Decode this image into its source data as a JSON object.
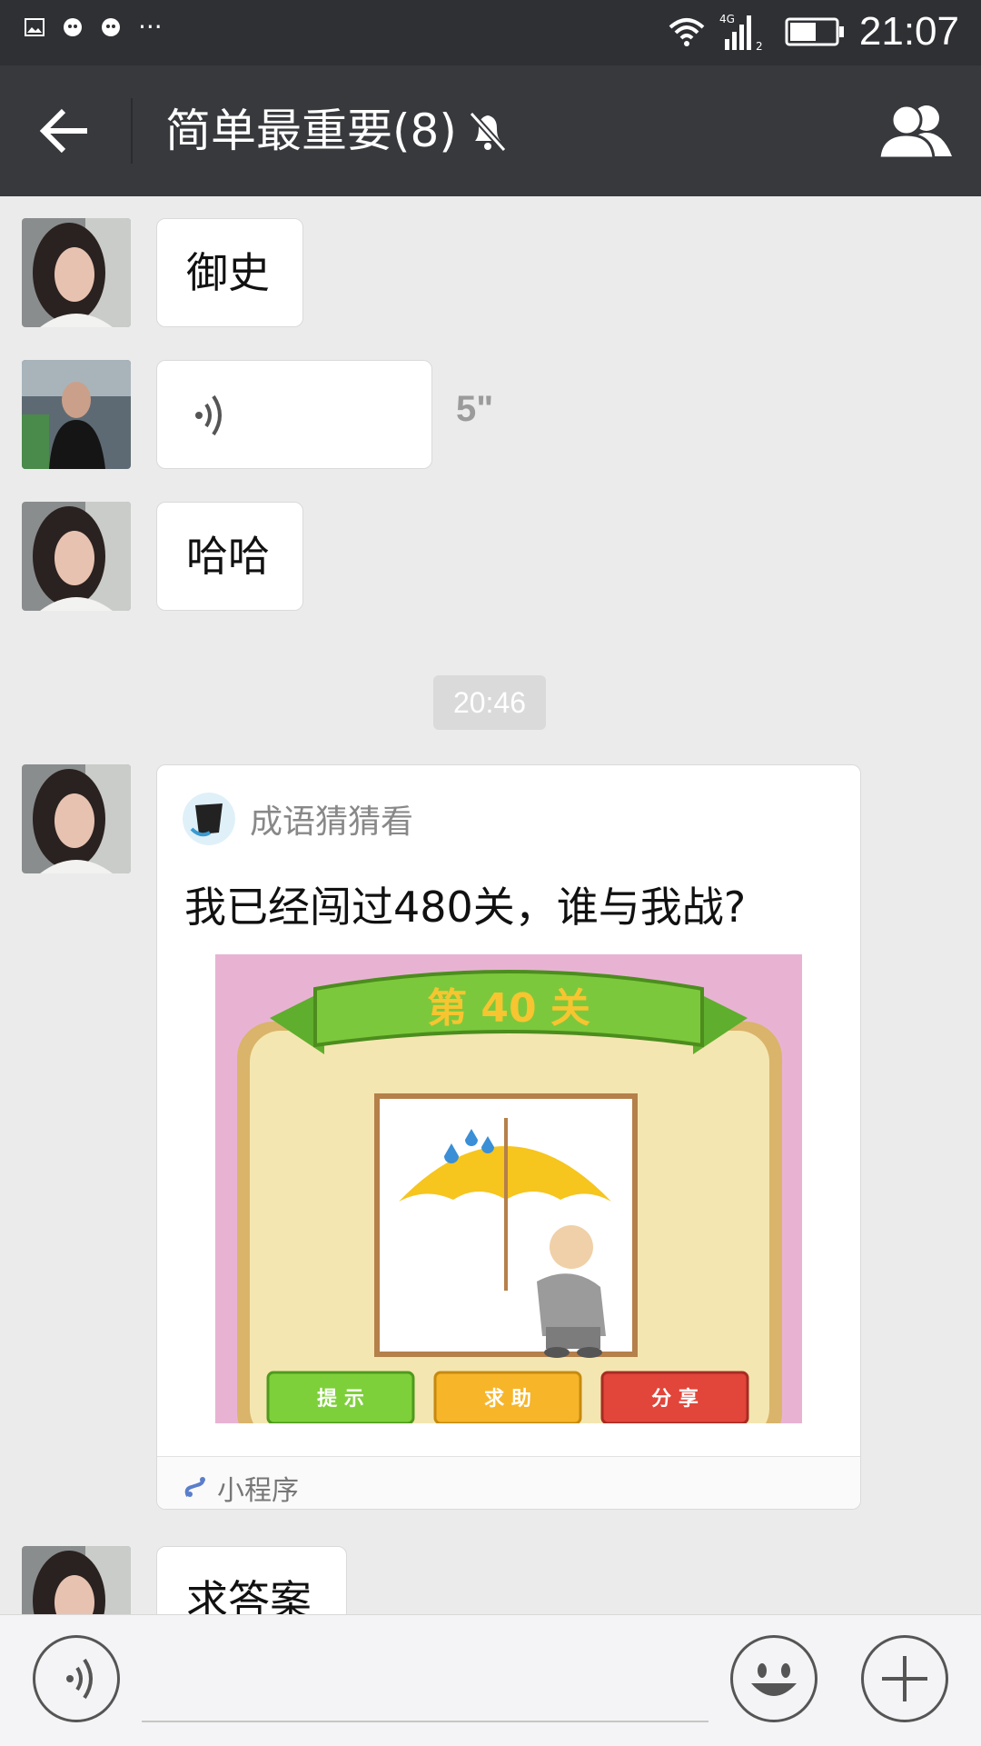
{
  "status_bar": {
    "time": "21:07",
    "network": "4G",
    "sim": "2",
    "overflow": "···"
  },
  "nav": {
    "title": "简单最重要(8)",
    "icons": [
      "back-arrow-icon",
      "mute-bell-icon",
      "group-members-icon"
    ]
  },
  "messages": [
    {
      "type": "text",
      "text": "御史"
    },
    {
      "type": "voice",
      "duration": "5\""
    },
    {
      "type": "text",
      "text": "哈哈"
    },
    {
      "type": "time",
      "text": "20:46"
    },
    {
      "type": "mini_program",
      "app_name": "成语猜猜看",
      "title": "我已经闯过480关，谁与我战?",
      "preview": {
        "level_text": "第 40 关",
        "buttons": [
          "提 示",
          "求 助",
          "分 享"
        ]
      },
      "footer": "小程序"
    },
    {
      "type": "text",
      "text": "求答案"
    }
  ],
  "input_bar": {
    "icons": [
      "voice-input-icon",
      "emoji-icon",
      "plus-icon"
    ]
  }
}
